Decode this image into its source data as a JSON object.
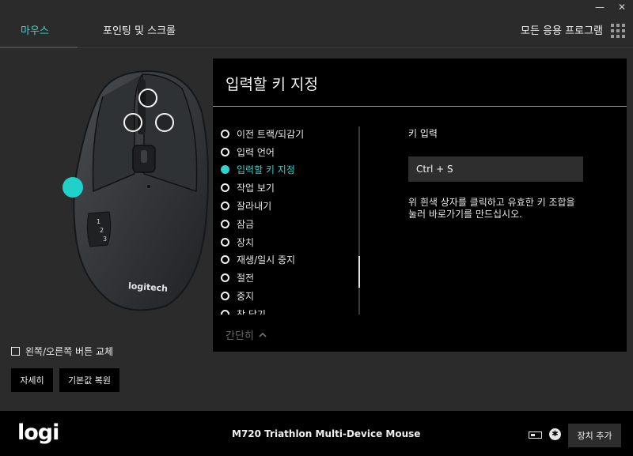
{
  "window": {
    "minimize": "—",
    "close": "✕"
  },
  "header": {
    "tabs": [
      {
        "label": "마우스",
        "active": true
      },
      {
        "label": "포인팅 및 스크롤",
        "active": false
      }
    ],
    "all_apps": "모든 응용 프로그램",
    "accent": "#3ad6cf"
  },
  "mouse": {
    "brand_text": "logitech",
    "thumb_buttons": [
      "1",
      "2",
      "3"
    ]
  },
  "panel": {
    "title": "입력할 키 지정",
    "actions": [
      {
        "label": "이전 트랙/되감기",
        "selected": false
      },
      {
        "label": "입력 언어",
        "selected": false
      },
      {
        "label": "입력할 키 지정",
        "selected": true
      },
      {
        "label": "작업 보기",
        "selected": false
      },
      {
        "label": "잘라내기",
        "selected": false
      },
      {
        "label": "잠금",
        "selected": false
      },
      {
        "label": "장치",
        "selected": false
      },
      {
        "label": "재생/일시 중지",
        "selected": false
      },
      {
        "label": "절전",
        "selected": false
      },
      {
        "label": "중지",
        "selected": false
      },
      {
        "label": "창 닫기",
        "selected": false
      }
    ],
    "collapse_label": "간단히",
    "key_input_label": "키 입력",
    "key_input_value": "Ctrl + S",
    "help_text": "위 흰색 상자를 클릭하고 유효한 키 조합을 눌러 바로가기를 만드십시오."
  },
  "controls": {
    "swap_label": "왼쪽/오른쪽 버튼 교체",
    "details_button": "자세히",
    "restore_button": "기본값 복원"
  },
  "footer": {
    "logo": "logi",
    "device_name": "M720 Triathlon Multi-Device Mouse",
    "add_device_button": "장치 추가"
  }
}
